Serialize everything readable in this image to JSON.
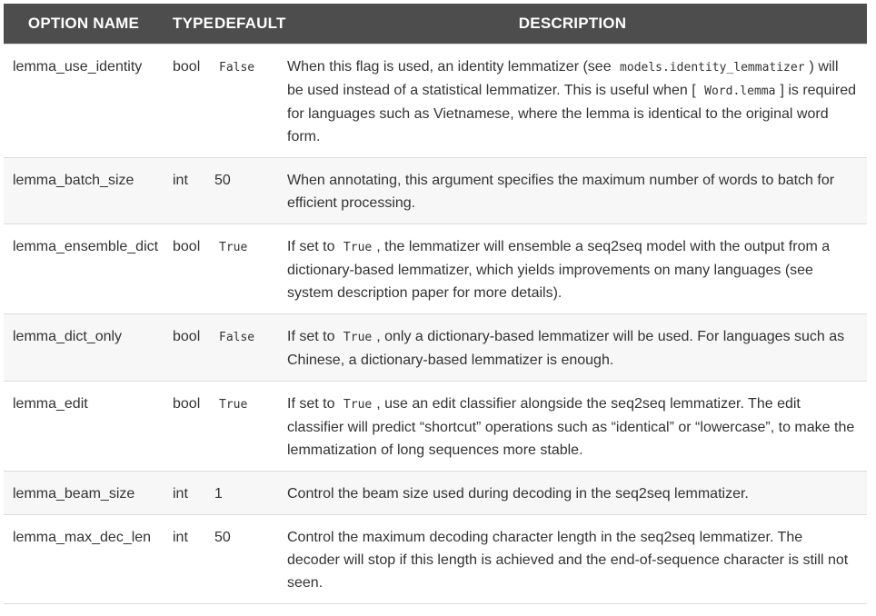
{
  "headers": {
    "name": "OPTION NAME",
    "type": "TYPE",
    "default": "DEFAULT",
    "description": "DESCRIPTION"
  },
  "rows": [
    {
      "name": "lemma_use_identity",
      "type": "bool",
      "default": "False",
      "default_mono": true,
      "desc": [
        {
          "t": "When this flag is used, an identity lemmatizer (see "
        },
        {
          "c": "models.identity_lemmatizer"
        },
        {
          "t": ") will be used instead of a statistical lemmatizer. This is useful when [ "
        },
        {
          "c": "Word.lemma"
        },
        {
          "t": "] is required for languages such as Vietnamese, where the lemma is identical to the original word form."
        }
      ]
    },
    {
      "name": "lemma_batch_size",
      "type": "int",
      "default": "50",
      "default_mono": false,
      "desc": [
        {
          "t": "When annotating, this argument specifies the maximum number of words to batch for efficient processing."
        }
      ]
    },
    {
      "name": "lemma_ensemble_dict",
      "type": "bool",
      "default": "True",
      "default_mono": true,
      "desc": [
        {
          "t": "If set to "
        },
        {
          "c": "True"
        },
        {
          "t": ", the lemmatizer will ensemble a seq2seq model with the output from a dictionary-based lemmatizer, which yields improvements on many languages (see system description paper for more details)."
        }
      ]
    },
    {
      "name": "lemma_dict_only",
      "type": "bool",
      "default": "False",
      "default_mono": true,
      "desc": [
        {
          "t": "If set to "
        },
        {
          "c": "True"
        },
        {
          "t": ", only a dictionary-based lemmatizer will be used. For languages such as Chinese, a dictionary-based lemmatizer is enough."
        }
      ]
    },
    {
      "name": "lemma_edit",
      "type": "bool",
      "default": "True",
      "default_mono": true,
      "desc": [
        {
          "t": "If set to "
        },
        {
          "c": "True"
        },
        {
          "t": ", use an edit classifier alongside the seq2seq lemmatizer. The edit classifier will predict “shortcut” operations such as “identical” or “lowercase”, to make the lemmatization of long sequences more stable."
        }
      ]
    },
    {
      "name": "lemma_beam_size",
      "type": "int",
      "default": "1",
      "default_mono": false,
      "desc": [
        {
          "t": "Control the beam size used during decoding in the seq2seq lemmatizer."
        }
      ]
    },
    {
      "name": "lemma_max_dec_len",
      "type": "int",
      "default": "50",
      "default_mono": false,
      "desc": [
        {
          "t": "Control the maximum decoding character length in the seq2seq lemmatizer. The decoder will stop if this length is achieved and the end-of-sequence character is still not seen."
        }
      ]
    }
  ]
}
